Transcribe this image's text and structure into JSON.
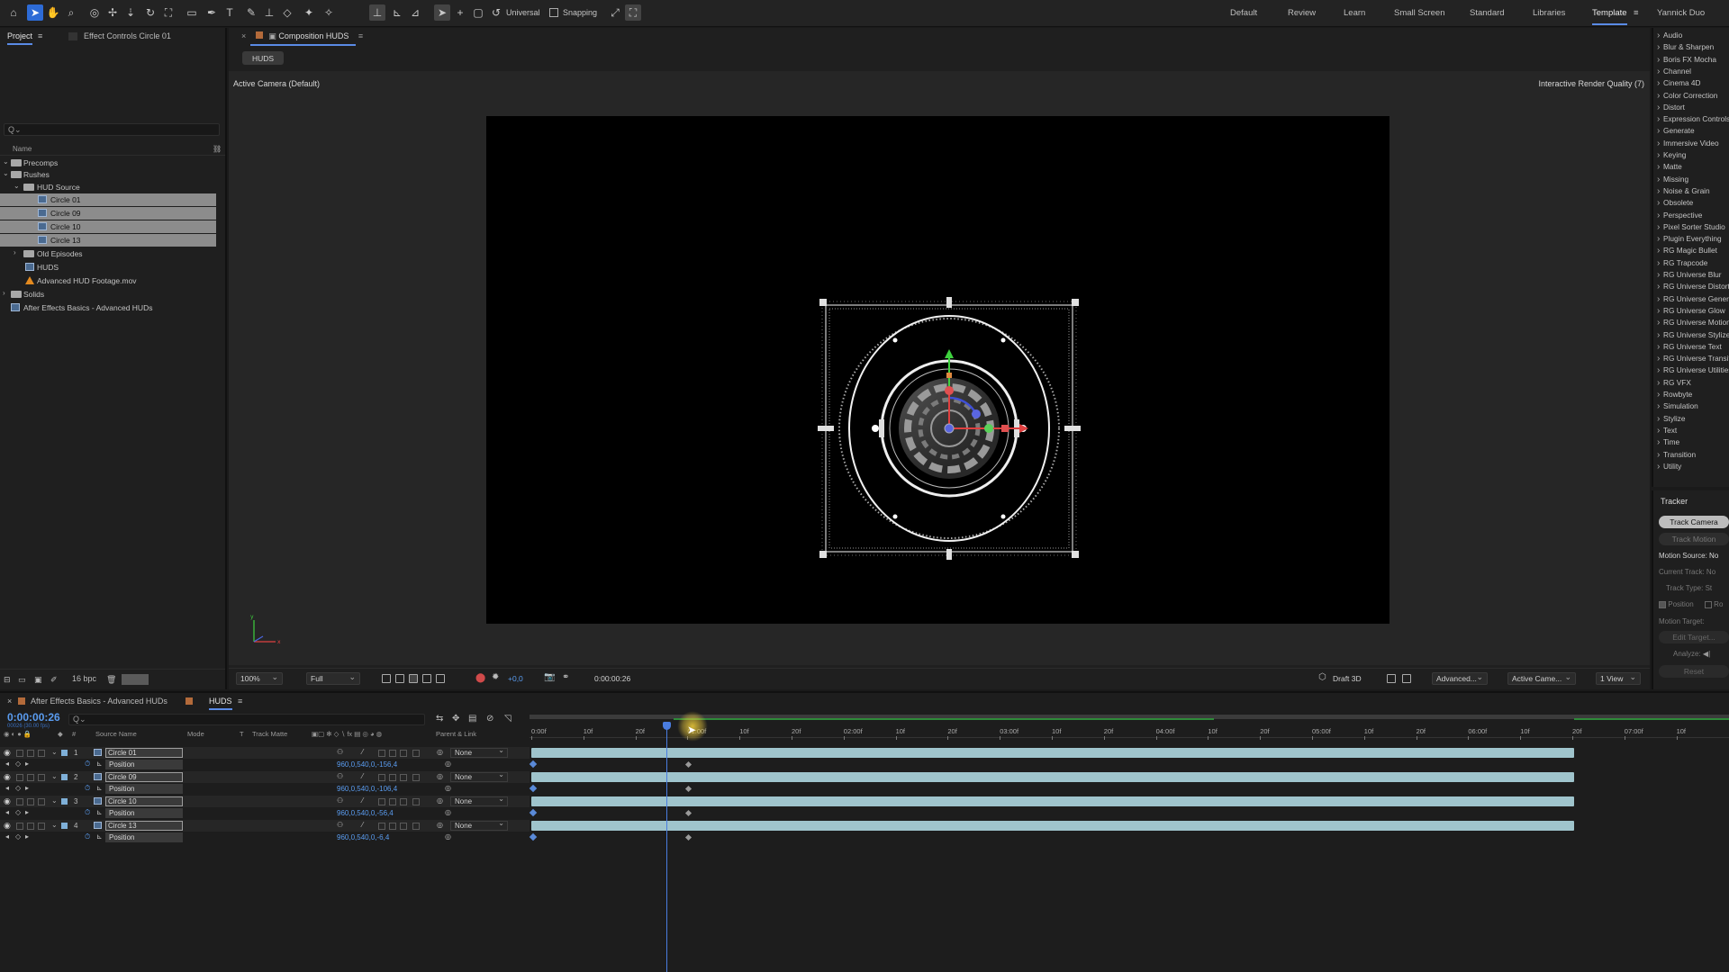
{
  "toolbar": {
    "universal_label": "Universal",
    "snapping_label": "Snapping",
    "workspaces": [
      "Default",
      "Review",
      "Learn",
      "Small Screen",
      "Standard",
      "Libraries",
      "Template"
    ],
    "active_workspace": "Template",
    "user": "Yannick Duo"
  },
  "project": {
    "tab_project": "Project",
    "tab_effect_controls": "Effect Controls Circle 01",
    "search_placeholder": "Q⌄",
    "col_name": "Name",
    "bpc": "16 bpc",
    "items": [
      {
        "label": "Precomps",
        "type": "folder",
        "indent": 0,
        "open": true
      },
      {
        "label": "Rushes",
        "type": "folder",
        "indent": 0,
        "open": true
      },
      {
        "label": "HUD Source",
        "type": "folder",
        "indent": 1,
        "open": true
      },
      {
        "label": "Circle 01",
        "type": "comp",
        "indent": 2,
        "selected": true
      },
      {
        "label": "Circle 09",
        "type": "comp",
        "indent": 2,
        "selected": true
      },
      {
        "label": "Circle 10",
        "type": "comp",
        "indent": 2,
        "selected": true
      },
      {
        "label": "Circle 13",
        "type": "comp",
        "indent": 2,
        "selected": true
      },
      {
        "label": "Old Episodes",
        "type": "folder",
        "indent": 1,
        "open": false
      },
      {
        "label": "HUDS",
        "type": "comp",
        "indent": 1
      },
      {
        "label": "Advanced HUD Footage.mov",
        "type": "footage",
        "indent": 1
      },
      {
        "label": "Solids",
        "type": "folder",
        "indent": 0,
        "open": false
      },
      {
        "label": "After Effects Basics - Advanced HUDs",
        "type": "comp",
        "indent": 0
      }
    ]
  },
  "composition": {
    "tab_label": "Composition HUDS",
    "flow_chip": "HUDS",
    "camera_label": "Active Camera (Default)",
    "render_quality": "Interactive Render Quality (7)",
    "zoom": "100%",
    "resolution": "Full",
    "exposure": "+0,0",
    "current_time": "0:00:00:26",
    "renderer": "Draft 3D",
    "advanced": "Advanced...",
    "camera_dd": "Active Came...",
    "view_dd": "1 View"
  },
  "effects": [
    "Audio",
    "Blur & Sharpen",
    "Boris FX Mocha",
    "Channel",
    "Cinema 4D",
    "Color Correction",
    "Distort",
    "Expression Controls",
    "Generate",
    "Immersive Video",
    "Keying",
    "Matte",
    "Missing",
    "Noise & Grain",
    "Obsolete",
    "Perspective",
    "Pixel Sorter Studio",
    "Plugin Everything",
    "RG Magic Bullet",
    "RG Trapcode",
    "RG Universe Blur",
    "RG Universe Distort",
    "RG Universe Generators",
    "RG Universe Glow",
    "RG Universe Motion",
    "RG Universe Stylize",
    "RG Universe Text",
    "RG Universe Transitions",
    "RG Universe Utilities",
    "RG VFX",
    "Rowbyte",
    "Simulation",
    "Stylize",
    "Text",
    "Time",
    "Transition",
    "Utility"
  ],
  "tracker": {
    "title": "Tracker",
    "track_camera": "Track Camera",
    "track_motion": "Track Motion",
    "motion_source_label": "Motion Source:",
    "motion_source_val": "No",
    "current_track": "Current Track:",
    "current_track_val": "No",
    "track_type": "Track Type:",
    "track_type_val": "St",
    "position": "Position",
    "rotation": "Ro",
    "motion_target": "Motion Target:",
    "edit_target": "Edit Target...",
    "analyze": "Analyze:",
    "reset": "Reset"
  },
  "timeline": {
    "tab_parent": "After Effects Basics - Advanced HUDs",
    "tab_active": "HUDS",
    "timecode": "0:00:00:26",
    "frames_sub": "00026 (30.00 fps)",
    "search_placeholder": "Q⌄",
    "col_source_name": "Source Name",
    "col_mode": "Mode",
    "col_t": "T",
    "col_track_matte": "Track Matte",
    "col_parent": "Parent & Link",
    "layers": [
      {
        "num": "1",
        "name": "Circle 01",
        "parent": "None",
        "prop": "Position",
        "pos": "960,0,540,0,-156,4"
      },
      {
        "num": "2",
        "name": "Circle 09",
        "parent": "None",
        "prop": "Position",
        "pos": "960,0,540,0,-106,4"
      },
      {
        "num": "3",
        "name": "Circle 10",
        "parent": "None",
        "prop": "Position",
        "pos": "960,0,540,0,-56,4"
      },
      {
        "num": "4",
        "name": "Circle 13",
        "parent": "None",
        "prop": "Position",
        "pos": "960,0,540,0,-6,4"
      }
    ],
    "ruler_ticks": [
      "0:00f",
      "10f",
      "20f",
      "01:00f",
      "10f",
      "20f",
      "02:00f",
      "10f",
      "20f",
      "03:00f",
      "10f",
      "20f",
      "04:00f",
      "10f",
      "20f",
      "05:00f",
      "10f",
      "20f",
      "06:00f",
      "10f",
      "20f",
      "07:00f",
      "10f"
    ]
  }
}
